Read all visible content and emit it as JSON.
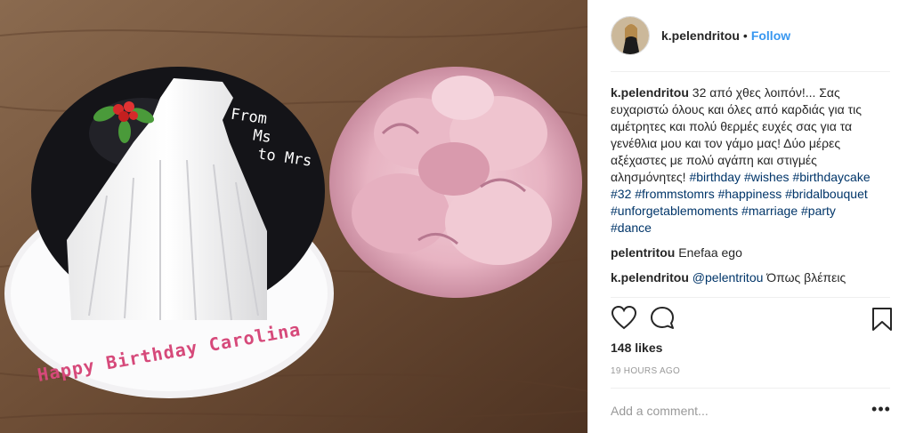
{
  "post": {
    "image_icon": "cake-and-bouquet-photo",
    "cake_text_top": [
      "From",
      "Ms",
      "to Mrs"
    ],
    "cake_text_bottom": "Happy Birthday Carolina"
  },
  "header": {
    "username": "k.pelendritou",
    "separator": "•",
    "follow_label": "Follow"
  },
  "caption": {
    "username": "k.pelendritou",
    "text": "32 από χθες λοιπόν!... Σας ευχαριστώ όλους και όλες από καρδιάς για τις αμέτρητες και πολύ θερμές ευχές σας για τα γενέθλια μου και τον γάμο μας! Δύο μέρες αξέχαστες με πολύ αγάπη και στιγμές αλησμόνητες!",
    "hashtags": [
      "#birthday",
      "#wishes",
      "#birthdaycake",
      "#32",
      "#frommstomrs",
      "#happiness",
      "#bridalbouquet",
      "#unforgetablemoments",
      "#marriage",
      "#party",
      "#dance"
    ]
  },
  "comments": [
    {
      "username": "pelentritou",
      "text": "Enefaa ego"
    },
    {
      "username": "k.pelendritou",
      "mention": "@pelentritou",
      "text": "Όπως βλέπεις"
    }
  ],
  "actions": {
    "like_icon": "heart-icon",
    "comment_icon": "comment-bubble-icon",
    "save_icon": "bookmark-icon"
  },
  "likes_label": "148 likes",
  "timestamp": "19 HOURS AGO",
  "add_comment_placeholder": "Add a comment...",
  "more_label": "•••",
  "colors": {
    "link": "#003569",
    "follow": "#3897f0",
    "muted": "#999999"
  }
}
